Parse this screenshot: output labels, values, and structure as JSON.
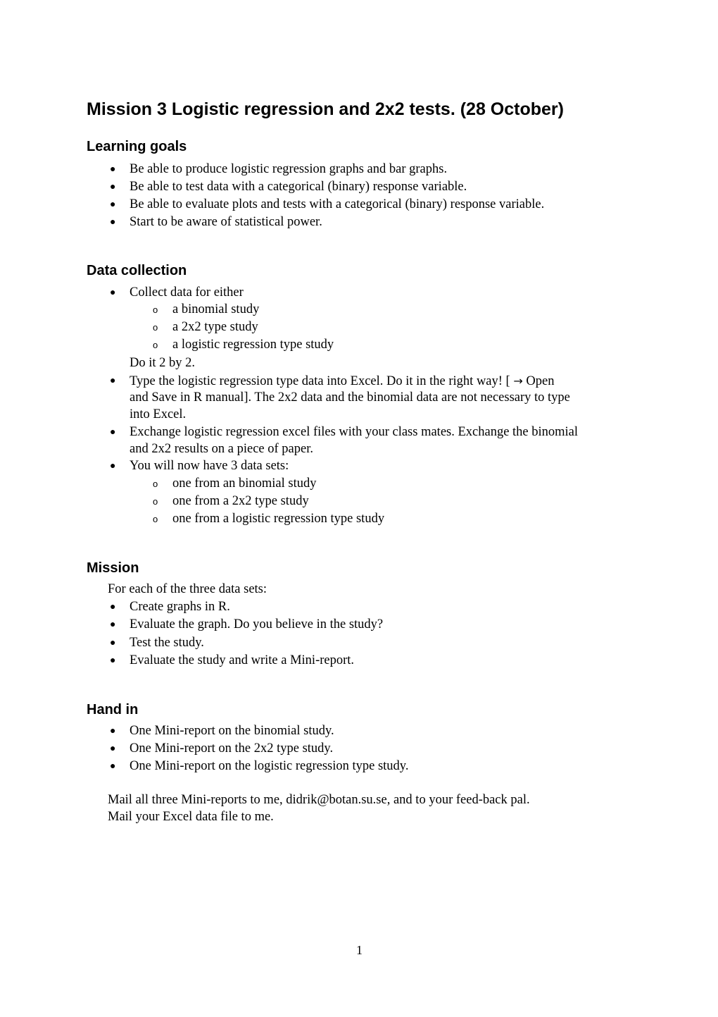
{
  "document": {
    "title": "Mission 3 Logistic regression and 2x2 tests. (28 October)",
    "page_number": "1",
    "sections": {
      "learning_goals": {
        "heading": "Learning goals",
        "items": [
          "Be able to produce logistic regression graphs and bar graphs.",
          "Be able to test data with a categorical (binary) response variable.",
          "Be able to evaluate plots and tests with a categorical (binary) response variable.",
          "Start to be aware of statistical power."
        ]
      },
      "data_collection": {
        "heading": "Data collection",
        "item1": "Collect data for either",
        "item1_sub": [
          "a binomial study",
          "a 2x2 type study",
          "a logistic regression type study"
        ],
        "item1_note": "Do it 2 by 2.",
        "item2_line1_a": "Type the logistic regression type data into Excel. Do it in the right way!  [ ",
        "item2_arrow": "→",
        "item2_line1_b": " Open",
        "item2_line2": "and Save in R manual]. The 2x2 data and the binomial data are not necessary to type",
        "item2_line3": "into Excel.",
        "item3_line1": "Exchange logistic regression excel files with your class mates. Exchange the binomial",
        "item3_line2": "and 2x2 results on a piece of paper.",
        "item4": "You will now have 3 data sets:",
        "item4_sub": [
          "one from an binomial study",
          "one from a 2x2 type study",
          "one from a logistic regression type study"
        ]
      },
      "mission": {
        "heading": "Mission",
        "intro": "For each of the three data sets:",
        "items": [
          "Create graphs in R.",
          "Evaluate the graph. Do you believe in the study?",
          "Test the study.",
          "Evaluate the study and write a Mini-report."
        ]
      },
      "hand_in": {
        "heading": "Hand in",
        "items": [
          "One Mini-report on the binomial study.",
          "One Mini-report on the 2x2 type study.",
          "One Mini-report on the logistic regression type study."
        ],
        "mail_line1": "Mail all three Mini-reports to me, didrik@botan.su.se, and to your feed-back pal.",
        "mail_line2": "Mail your Excel data file to me."
      }
    }
  }
}
